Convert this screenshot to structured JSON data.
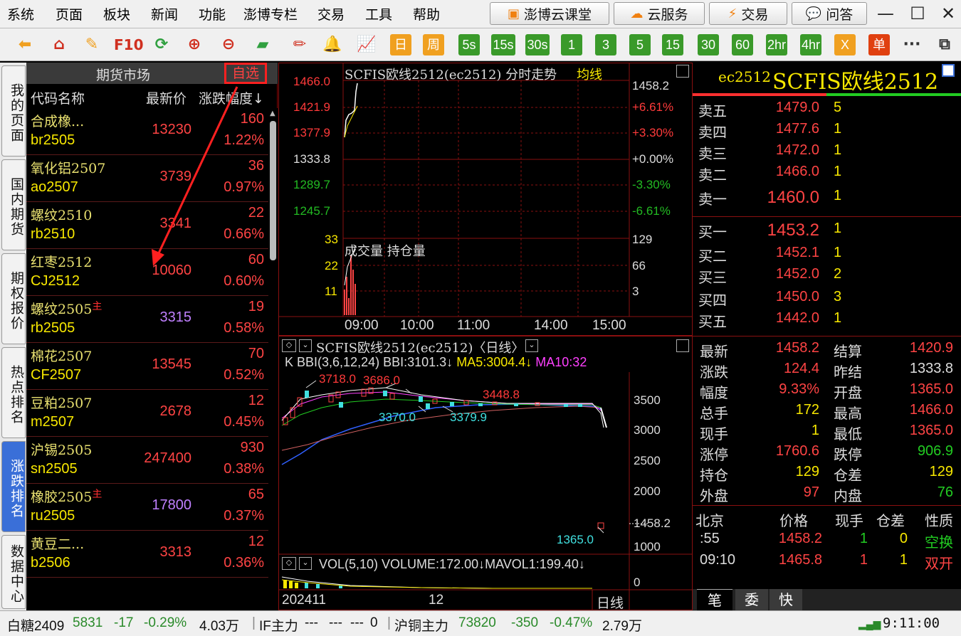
{
  "menu": {
    "items": [
      "系统",
      "页面",
      "板块",
      "新闻",
      "功能",
      "澎博专栏",
      "交易",
      "工具",
      "帮助"
    ],
    "right_buttons": [
      {
        "label": "澎博云课堂",
        "icon": "classroom-icon"
      },
      {
        "label": "云服务",
        "icon": "cloud-icon"
      },
      {
        "label": "交易",
        "icon": "lightning-icon"
      },
      {
        "label": "问答",
        "icon": "chat-icon"
      }
    ]
  },
  "toolbar": {
    "icons": [
      "back-arrow-icon",
      "home-icon",
      "notes-icon",
      "f10-icon",
      "refresh-icon",
      "zoom-in-icon",
      "zoom-out-icon",
      "window-icon",
      "draw-pen-icon",
      "alert-bell-icon",
      "trend-chart-icon"
    ],
    "f10_label": "F10",
    "periods": [
      {
        "label": "日",
        "style": "orange"
      },
      {
        "label": "周",
        "style": "orange"
      },
      {
        "label": "5s",
        "style": "green"
      },
      {
        "label": "15s",
        "style": "green"
      },
      {
        "label": "30s",
        "style": "green"
      },
      {
        "label": "1",
        "style": "green"
      },
      {
        "label": "3",
        "style": "green"
      },
      {
        "label": "5",
        "style": "green"
      },
      {
        "label": "15",
        "style": "green"
      },
      {
        "label": "30",
        "style": "green"
      },
      {
        "label": "60",
        "style": "green"
      },
      {
        "label": "2hr",
        "style": "green"
      },
      {
        "label": "4hr",
        "style": "green"
      },
      {
        "label": "X",
        "style": "orange"
      },
      {
        "label": "单",
        "style": "red"
      }
    ],
    "more": "···"
  },
  "left_tabs": [
    {
      "label": "我的页面",
      "active": false
    },
    {
      "label": "国内期货",
      "active": false
    },
    {
      "label": "期权报价",
      "active": false
    },
    {
      "label": "热点排名",
      "active": false
    },
    {
      "label": "涨跌排名",
      "active": true
    },
    {
      "label": "数据中心",
      "active": false
    }
  ],
  "futures": {
    "title": "期货市场",
    "watch_label": "自选",
    "columns": {
      "name": "代码名称",
      "price": "最新价",
      "change": "涨跌幅度↓"
    },
    "rows": [
      {
        "name": "合成橡...",
        "code": "br2505",
        "price": "13230",
        "change": "160",
        "pct": "1.22%",
        "main": false,
        "price_color": "#ff4444"
      },
      {
        "name": "氧化铝2507",
        "code": "ao2507",
        "price": "3739",
        "change": "36",
        "pct": "0.97%",
        "main": false,
        "price_color": "#ff4444"
      },
      {
        "name": "螺纹2510",
        "code": "rb2510",
        "price": "3341",
        "change": "22",
        "pct": "0.66%",
        "main": false,
        "price_color": "#ff4444"
      },
      {
        "name": "红枣2512",
        "code": "CJ2512",
        "price": "10060",
        "change": "60",
        "pct": "0.60%",
        "main": false,
        "price_color": "#ff4444"
      },
      {
        "name": "螺纹2505",
        "code": "rb2505",
        "price": "3315",
        "change": "19",
        "pct": "0.58%",
        "main": true,
        "price_color": "#c080ff"
      },
      {
        "name": "棉花2507",
        "code": "CF2507",
        "price": "13545",
        "change": "70",
        "pct": "0.52%",
        "main": false,
        "price_color": "#ff4444"
      },
      {
        "name": "豆粕2507",
        "code": "m2507",
        "price": "2678",
        "change": "12",
        "pct": "0.45%",
        "main": false,
        "price_color": "#ff4444"
      },
      {
        "name": "沪锡2505",
        "code": "sn2505",
        "price": "247400",
        "change": "930",
        "pct": "0.38%",
        "main": false,
        "price_color": "#ff4444"
      },
      {
        "name": "橡胶2505",
        "code": "ru2505",
        "price": "17800",
        "change": "65",
        "pct": "0.37%",
        "main": true,
        "price_color": "#c080ff"
      },
      {
        "name": "黄豆二...",
        "code": "b2506",
        "price": "3313",
        "change": "12",
        "pct": "0.36%",
        "main": false,
        "price_color": "#ff4444"
      }
    ],
    "main_mark": "主"
  },
  "intraday": {
    "title": "SCFIS欧线2512(ec2512) 分时走势",
    "avg_label": "均线",
    "price_left": [
      "1466.0",
      "1421.9",
      "1377.9",
      "1333.8",
      "1289.7",
      "1245.7"
    ],
    "pct_right": [
      "1458.2",
      "+6.61%",
      "+3.30%",
      "+0.00%",
      "-3.30%",
      "-6.61%"
    ],
    "vol_left": [
      "33",
      "22",
      "11"
    ],
    "vol_right": [
      "129",
      "66",
      "3"
    ],
    "vol_title": "成交量 持仓量",
    "times": [
      "09:00",
      "10:00",
      "11:00",
      "14:00",
      "15:00"
    ]
  },
  "kline": {
    "title": "SCFIS欧线2512(ec2512)〈日线〉",
    "indicator": {
      "k": "K",
      "bbi": "BBI(3,6,12,24) BBI:3101.3↓",
      "ma5": "MA5:3004.4↓",
      "ma10": "MA10:32"
    },
    "y_labels": [
      "3500",
      "3000",
      "2500",
      "2000",
      "1458.2",
      "1000"
    ],
    "annotations": {
      "a1": "3718.0",
      "a2": "3686.0",
      "a3": "3448.8",
      "a4": "3370.0",
      "a5": "3379.9",
      "a6": "1365.0"
    },
    "vol_line": "VOL(5,10) VOLUME:172.00↓MAVOL1:199.40↓",
    "vol_zero": "0",
    "x_labels": [
      "202411",
      "12"
    ],
    "period": "日线"
  },
  "quote": {
    "code": "ec2512",
    "name": "SCFIS欧线2512",
    "asks": [
      {
        "label": "卖五",
        "price": "1479.0",
        "vol": "5"
      },
      {
        "label": "卖四",
        "price": "1477.6",
        "vol": "1"
      },
      {
        "label": "卖三",
        "price": "1472.0",
        "vol": "1"
      },
      {
        "label": "卖二",
        "price": "1466.0",
        "vol": "1"
      },
      {
        "label": "卖一",
        "price": "1460.0",
        "vol": "1"
      }
    ],
    "bids": [
      {
        "label": "买一",
        "price": "1453.2",
        "vol": "1"
      },
      {
        "label": "买二",
        "price": "1452.1",
        "vol": "1"
      },
      {
        "label": "买三",
        "price": "1452.0",
        "vol": "2"
      },
      {
        "label": "买四",
        "price": "1450.0",
        "vol": "3"
      },
      {
        "label": "买五",
        "price": "1442.0",
        "vol": "1"
      }
    ],
    "stats": [
      {
        "k1": "最新",
        "v1": "1458.2",
        "c1": "#ff4444",
        "k2": "结算",
        "v2": "1420.9",
        "c2": "#ff4444"
      },
      {
        "k1": "涨跌",
        "v1": "124.4",
        "c1": "#ff4444",
        "k2": "昨结",
        "v2": "1333.8",
        "c2": "#dddddd"
      },
      {
        "k1": "幅度",
        "v1": "9.33%",
        "c1": "#ff4444",
        "k2": "开盘",
        "v2": "1365.0",
        "c2": "#ff4444"
      },
      {
        "k1": "总手",
        "v1": "172",
        "c1": "#f8e800",
        "k2": "最高",
        "v2": "1466.0",
        "c2": "#ff4444"
      },
      {
        "k1": "现手",
        "v1": "1",
        "c1": "#f8e800",
        "k2": "最低",
        "v2": "1365.0",
        "c2": "#ff4444"
      },
      {
        "k1": "涨停",
        "v1": "1760.6",
        "c1": "#ff4444",
        "k2": "跌停",
        "v2": "906.9",
        "c2": "#22cc22"
      },
      {
        "k1": "持仓",
        "v1": "129",
        "c1": "#f8e800",
        "k2": "仓差",
        "v2": "129",
        "c2": "#f8e800"
      },
      {
        "k1": "外盘",
        "v1": "97",
        "c1": "#ff4444",
        "k2": "内盘",
        "v2": "76",
        "c2": "#22cc22"
      }
    ],
    "trades_header": [
      "北京",
      "价格",
      "现手",
      "仓差",
      "性质"
    ],
    "trades": [
      {
        "time": ":55",
        "price": "1458.2",
        "vol": "1",
        "oi": "0",
        "type": "空换",
        "type_color": "#22cc22"
      },
      {
        "time": "09:10",
        "price": "1465.8",
        "vol": "1",
        "oi": "1",
        "type": "双开",
        "type_color": "#ff4444"
      }
    ],
    "tabs": [
      "笔",
      "委",
      "快"
    ]
  },
  "statusbar": {
    "items": [
      {
        "name": "白糖2409",
        "price": "5831",
        "chg": "-17",
        "pct": "-0.29%",
        "vol": "4.03万"
      },
      {
        "name": "IF主力",
        "price": "---",
        "chg": "---",
        "pct": "---",
        "vol": "0"
      },
      {
        "name": "沪铜主力",
        "price": "73820",
        "chg": "-350",
        "pct": "-0.47%",
        "vol": "2.79万"
      }
    ],
    "time": "9:11:00"
  }
}
